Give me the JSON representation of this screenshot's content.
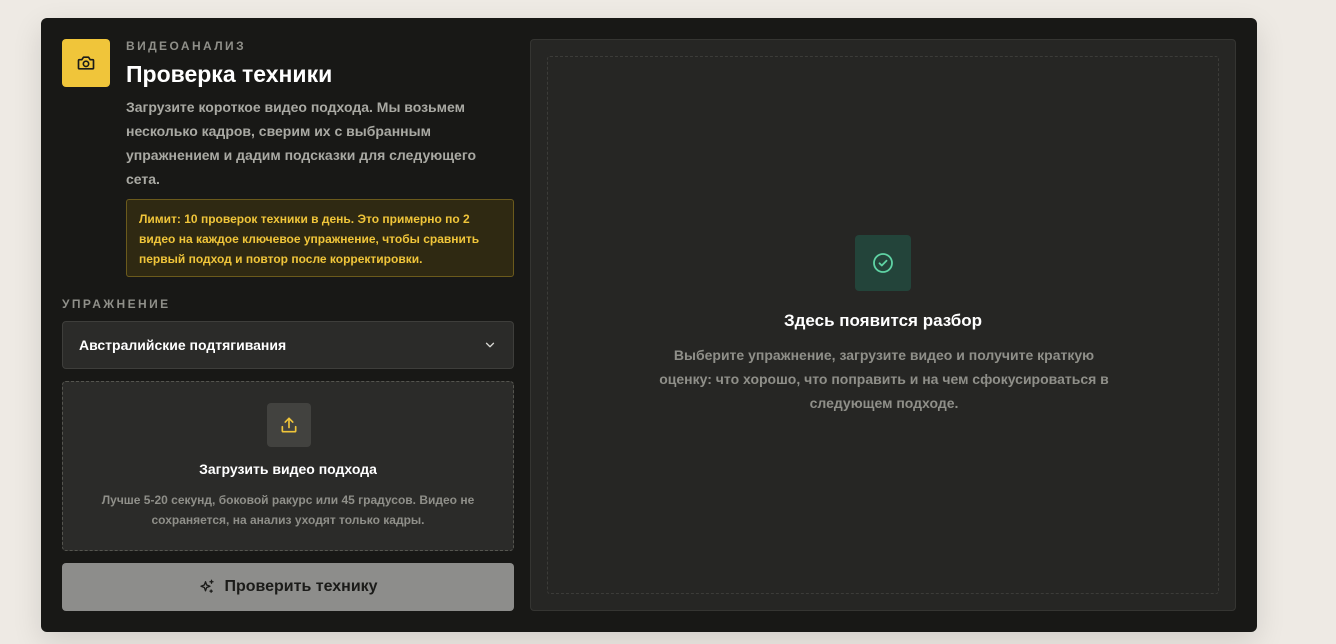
{
  "header": {
    "eyebrow": "ВИДЕОАНАЛИЗ",
    "title": "Проверка техники",
    "description": "Загрузите короткое видео подхода. Мы возьмем несколько кадров, сверим их с выбранным упражнением и дадим подсказки для следующего сета.",
    "icon": "camera-icon"
  },
  "limit_notice": "Лимит: 10 проверок техники в день. Это примерно по 2 видео на каждое ключевое упражнение, чтобы сравнить первый подход и повтор после корректировки.",
  "exercise": {
    "label": "УПРАЖНЕНИЕ",
    "selected": "Австралийские подтягивания"
  },
  "upload": {
    "title": "Загрузить видео подхода",
    "hint": "Лучше 5-20 секунд, боковой ракурс или 45 градусов. Видео не сохраняется, на анализ уходят только кадры."
  },
  "check_button": {
    "label": "Проверить технику"
  },
  "result": {
    "title": "Здесь появится разбор",
    "description": "Выберите упражнение, загрузите видео и получите краткую оценку: что хорошо, что поправить и на чем сфокусироваться в следующем подходе."
  },
  "colors": {
    "accent": "#f0c53a",
    "success": "#5fd3a4",
    "card_bg": "#181816",
    "page_bg": "#eeeae4"
  }
}
